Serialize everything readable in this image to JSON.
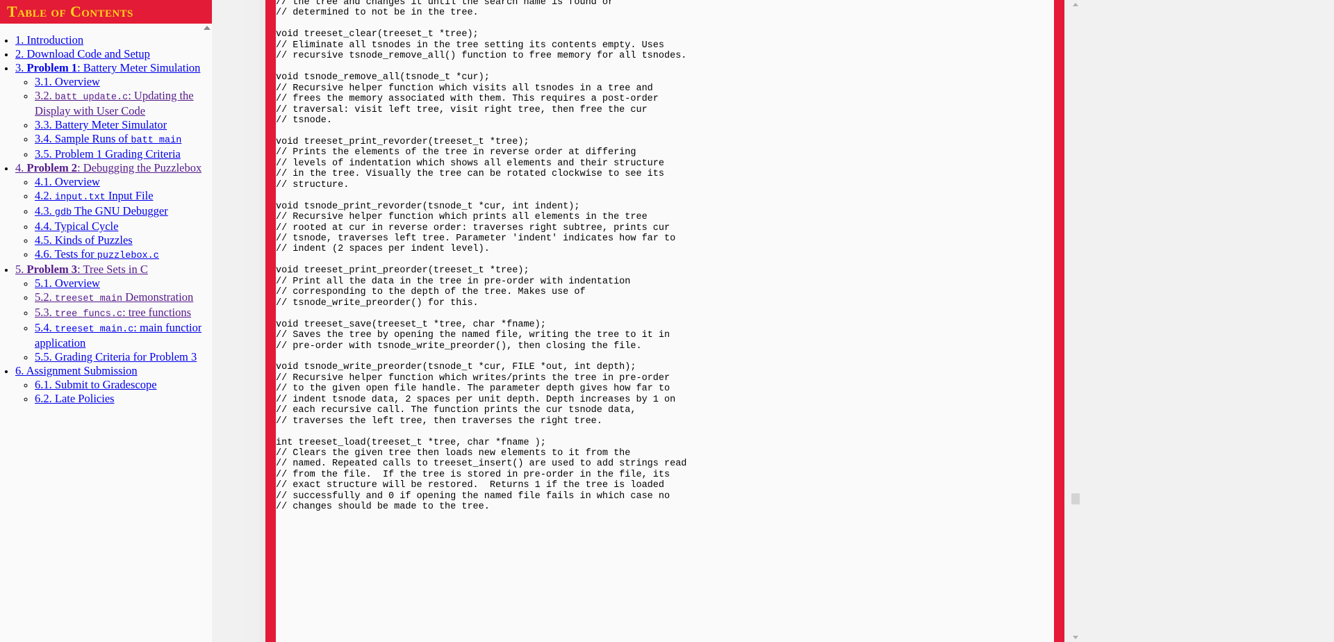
{
  "sidebar": {
    "header_title": "Table of Contents",
    "scroll_up_icon": "triangle-up-icon",
    "items": [
      {
        "level": 1,
        "visited": false,
        "parts": [
          {
            "t": "1. Introduction",
            "s": "n"
          }
        ]
      },
      {
        "level": 1,
        "visited": false,
        "parts": [
          {
            "t": "2. Download Code and Setup",
            "s": "n"
          }
        ]
      },
      {
        "level": 1,
        "visited": false,
        "parts": [
          {
            "t": "3. ",
            "s": "n"
          },
          {
            "t": "Problem 1",
            "s": "b"
          },
          {
            "t": ": Battery Meter Simulation",
            "s": "n"
          }
        ]
      },
      {
        "level": 2,
        "visited": false,
        "parts": [
          {
            "t": "3.1. Overview",
            "s": "n"
          }
        ]
      },
      {
        "level": 2,
        "visited": true,
        "parts": [
          {
            "t": "3.2. ",
            "s": "n"
          },
          {
            "t": "batt_update.c",
            "s": "c"
          },
          {
            "t": ": Updating the Display with User Code",
            "s": "n"
          }
        ]
      },
      {
        "level": 2,
        "visited": false,
        "parts": [
          {
            "t": "3.3. Battery Meter Simulator",
            "s": "n"
          }
        ]
      },
      {
        "level": 2,
        "visited": false,
        "parts": [
          {
            "t": "3.4. Sample Runs of ",
            "s": "n"
          },
          {
            "t": "batt_main",
            "s": "c"
          }
        ]
      },
      {
        "level": 2,
        "visited": false,
        "parts": [
          {
            "t": "3.5. Problem 1 Grading Criteria",
            "s": "n"
          }
        ]
      },
      {
        "level": 1,
        "visited": true,
        "parts": [
          {
            "t": "4. ",
            "s": "n"
          },
          {
            "t": "Problem 2",
            "s": "b"
          },
          {
            "t": ": Debugging the Puzzlebox",
            "s": "n"
          }
        ]
      },
      {
        "level": 2,
        "visited": false,
        "parts": [
          {
            "t": "4.1. Overview",
            "s": "n"
          }
        ]
      },
      {
        "level": 2,
        "visited": false,
        "parts": [
          {
            "t": "4.2. ",
            "s": "n"
          },
          {
            "t": "input.txt",
            "s": "c"
          },
          {
            "t": " Input File",
            "s": "n"
          }
        ]
      },
      {
        "level": 2,
        "visited": false,
        "parts": [
          {
            "t": "4.3. ",
            "s": "n"
          },
          {
            "t": "gdb",
            "s": "c"
          },
          {
            "t": " The GNU Debugger",
            "s": "n"
          }
        ]
      },
      {
        "level": 2,
        "visited": false,
        "parts": [
          {
            "t": "4.4. Typical Cycle",
            "s": "n"
          }
        ]
      },
      {
        "level": 2,
        "visited": false,
        "parts": [
          {
            "t": "4.5. Kinds of Puzzles",
            "s": "n"
          }
        ]
      },
      {
        "level": 2,
        "visited": false,
        "parts": [
          {
            "t": "4.6. Tests for ",
            "s": "n"
          },
          {
            "t": "puzzlebox.c",
            "s": "c"
          }
        ]
      },
      {
        "level": 1,
        "visited": true,
        "parts": [
          {
            "t": "5. ",
            "s": "n"
          },
          {
            "t": "Problem 3",
            "s": "b"
          },
          {
            "t": ": Tree Sets in C",
            "s": "n"
          }
        ]
      },
      {
        "level": 2,
        "visited": false,
        "parts": [
          {
            "t": "5.1. Overview",
            "s": "n"
          }
        ]
      },
      {
        "level": 2,
        "visited": true,
        "parts": [
          {
            "t": "5.2. ",
            "s": "n"
          },
          {
            "t": "treeset_main",
            "s": "c"
          },
          {
            "t": " Demonstration",
            "s": "n"
          }
        ]
      },
      {
        "level": 2,
        "visited": true,
        "parts": [
          {
            "t": "5.3. ",
            "s": "n"
          },
          {
            "t": "tree_funcs.c",
            "s": "c"
          },
          {
            "t": ": tree functions",
            "s": "n"
          }
        ]
      },
      {
        "level": 2,
        "visited": false,
        "parts": [
          {
            "t": "5.4. ",
            "s": "n"
          },
          {
            "t": "treeset_main.c",
            "s": "c"
          },
          {
            "t": ": main function / application",
            "s": "n"
          }
        ]
      },
      {
        "level": 2,
        "visited": false,
        "parts": [
          {
            "t": "5.5. Grading Criteria for Problem 3",
            "s": "n"
          }
        ]
      },
      {
        "level": 1,
        "visited": false,
        "parts": [
          {
            "t": "6. Assignment Submission",
            "s": "n"
          }
        ]
      },
      {
        "level": 2,
        "visited": false,
        "parts": [
          {
            "t": "6.1. Submit to Gradescope",
            "s": "n"
          }
        ]
      },
      {
        "level": 2,
        "visited": false,
        "parts": [
          {
            "t": "6.2. Late Policies",
            "s": "n"
          }
        ]
      }
    ]
  },
  "main": {
    "code": "// the tree and changes it until the search name is found or\n// determined to not be in the tree.\n\nvoid treeset_clear(treeset_t *tree);\n// Eliminate all tsnodes in the tree setting its contents empty. Uses\n// recursive tsnode_remove_all() function to free memory for all tsnodes.\n\nvoid tsnode_remove_all(tsnode_t *cur);\n// Recursive helper function which visits all tsnodes in a tree and\n// frees the memory associated with them. This requires a post-order\n// traversal: visit left tree, visit right tree, then free the cur\n// tsnode.\n\nvoid treeset_print_revorder(treeset_t *tree);\n// Prints the elements of the tree in reverse order at differing\n// levels of indentation which shows all elements and their structure\n// in the tree. Visually the tree can be rotated clockwise to see its\n// structure.\n\nvoid tsnode_print_revorder(tsnode_t *cur, int indent);\n// Recursive helper function which prints all elements in the tree\n// rooted at cur in reverse order: traverses right subtree, prints cur\n// tsnode, traverses left tree. Parameter 'indent' indicates how far to\n// indent (2 spaces per indent level).\n\nvoid treeset_print_preorder(treeset_t *tree);\n// Print all the data in the tree in pre-order with indentation\n// corresponding to the depth of the tree. Makes use of\n// tsnode_write_preorder() for this.\n\nvoid treeset_save(treeset_t *tree, char *fname);\n// Saves the tree by opening the named file, writing the tree to it in\n// pre-order with tsnode_write_preorder(), then closing the file.\n\nvoid tsnode_write_preorder(tsnode_t *cur, FILE *out, int depth);\n// Recursive helper function which writes/prints the tree in pre-order\n// to the given open file handle. The parameter depth gives how far to\n// indent tsnode data, 2 spaces per unit depth. Depth increases by 1 on\n// each recursive call. The function prints the cur tsnode data,\n// traverses the left tree, then traverses the right tree.\n\nint treeset_load(treeset_t *tree, char *fname );\n// Clears the given tree then loads new elements to it from the\n// named. Repeated calls to treeset_insert() are used to add strings read\n// from the file.  If the tree is stored in pre-order in the file, its\n// exact structure will be restored.  Returns 1 if the tree is loaded\n// successfully and 0 if opening the named file fails in which case no\n// changes should be made to the tree."
  },
  "scrollbars": {
    "window_up_icon": "scroll-arrow-up-icon",
    "window_down_icon": "scroll-arrow-down-icon",
    "window_thumb": "scroll-thumb"
  },
  "colors": {
    "accent_red": "#e31b36",
    "accent_yellow": "#ffd41a",
    "link": "#0000ee",
    "visited_link": "#551a8b",
    "page_bg": "#fafafa"
  }
}
